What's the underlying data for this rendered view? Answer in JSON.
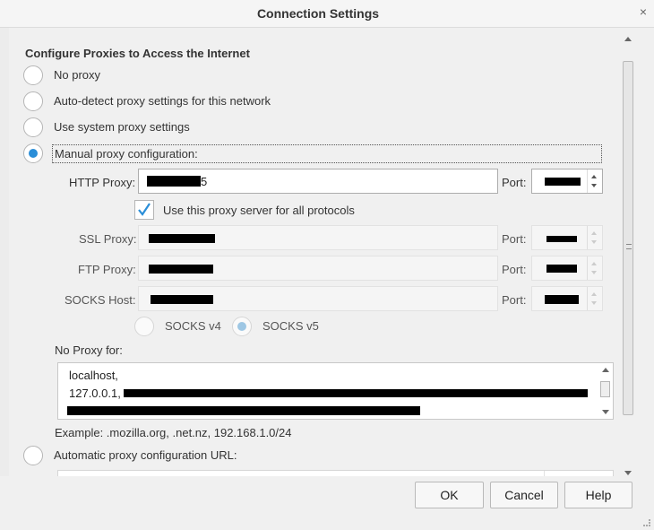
{
  "dialog": {
    "title": "Connection Settings",
    "close_glyph": "×"
  },
  "section": {
    "heading": "Configure Proxies to Access the Internet"
  },
  "proxy_options": {
    "no_proxy": "No proxy",
    "auto_detect": "Auto-detect proxy settings for this network",
    "system": "Use system proxy settings",
    "manual": "Manual proxy configuration:",
    "auto_url": "Automatic proxy configuration URL:"
  },
  "selected_option": "manual",
  "manual": {
    "http_label": "HTTP Proxy:",
    "http_visible_tail": "5",
    "port_label": "Port:",
    "use_for_all_label": "Use this proxy server for all protocols",
    "use_for_all_checked": true,
    "ssl_label": "SSL Proxy:",
    "ftp_label": "FTP Proxy:",
    "socks_label": "SOCKS Host:",
    "socks_v4": "SOCKS v4",
    "socks_v5": "SOCKS v5",
    "socks_selected": "v5"
  },
  "no_proxy": {
    "label": "No Proxy for:",
    "lines": [
      "localhost,",
      "127.0.0.1,"
    ],
    "example": "Example: .mozilla.org, .net.nz, 192.168.1.0/24"
  },
  "buttons": {
    "ok": "OK",
    "cancel": "Cancel",
    "help": "Help"
  },
  "colors": {
    "accent": "#2a8ed8",
    "background": "#f0f0f0"
  }
}
